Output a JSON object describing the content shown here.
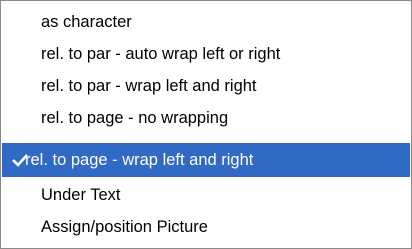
{
  "menu": {
    "items": [
      {
        "label": "as character",
        "selected": false
      },
      {
        "label": "rel. to par - auto wrap left or right",
        "selected": false
      },
      {
        "label": "rel. to par - wrap left and right",
        "selected": false
      },
      {
        "label": "rel. to page - no wrapping",
        "selected": false
      },
      {
        "label": "rel. to page - wrap left and right",
        "selected": true
      },
      {
        "label": "Under Text",
        "selected": false
      },
      {
        "label": "Assign/position Picture",
        "selected": false
      }
    ],
    "check_icon": "checkmark-icon",
    "highlight_color": "#316ac5",
    "highlight_text_color": "#ffffff"
  }
}
